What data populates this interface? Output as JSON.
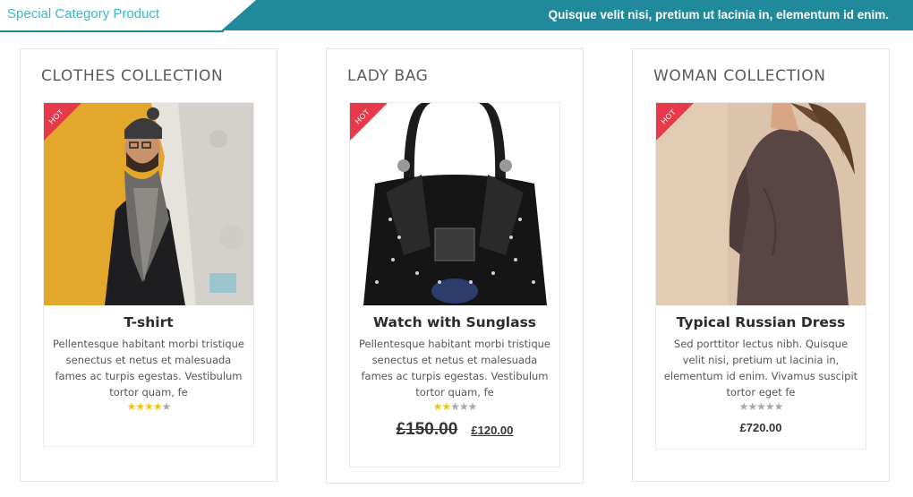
{
  "header": {
    "tab_title": "Special Category Product",
    "tagline": "Quisque velit nisi, pretium ut lacinia in, elementum id enim."
  },
  "colors": {
    "accent": "#20899b",
    "tab_text": "#3ab8cc",
    "hot": "#e8394a",
    "star_on": "#f1c40f",
    "star_off": "#a8a8a8"
  },
  "columns": [
    {
      "title": "CLOTHES COLLECTION",
      "badge": "HOT",
      "image_icon": "man-with-scarf-photo",
      "product": {
        "name": "T-shirt",
        "description": "Pellentesque habitant morbi tristique senectus et netus et malesuada fames ac turpis egestas. Vestibulum tortor quam, fe",
        "rating": 4,
        "rating_max": 5
      }
    },
    {
      "title": "LADY BAG",
      "badge": "HOT",
      "image_icon": "black-handbag-photo",
      "product": {
        "name": "Watch with Sunglass",
        "description": "Pellentesque habitant morbi tristique senectus et netus et malesuada fames ac turpis egestas. Vestibulum tortor quam, fe",
        "rating": 2,
        "rating_max": 5,
        "old_price": "£150.00",
        "price": "£120.00"
      }
    },
    {
      "title": "WOMAN COLLECTION",
      "badge": "HOT",
      "image_icon": "woman-dress-photo",
      "product": {
        "name": "Typical Russian Dress",
        "description": "Sed porttitor lectus nibh. Quisque velit nisi, pretium ut lacinia in, elementum id enim. Vivamus suscipit tortor eget fe",
        "rating": 0,
        "rating_max": 5,
        "price": "£720.00"
      }
    }
  ]
}
